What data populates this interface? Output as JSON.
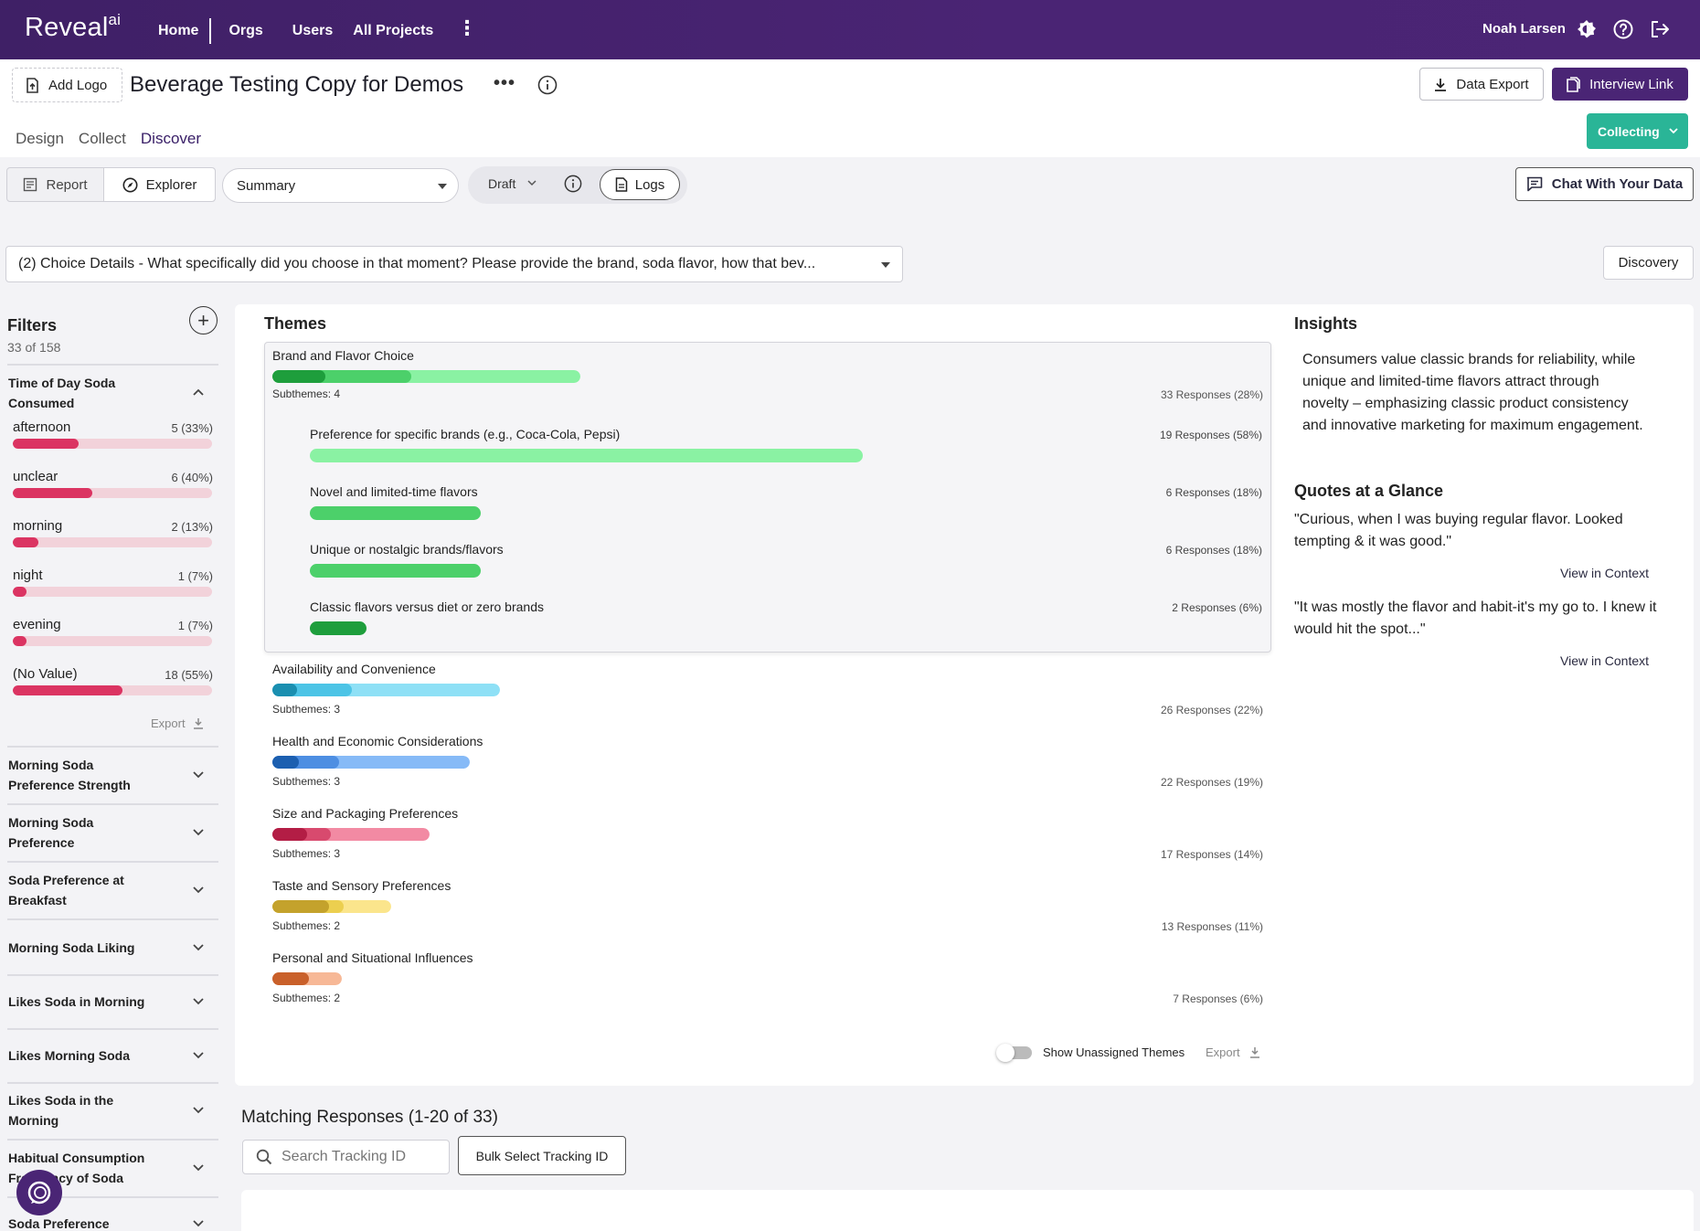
{
  "nav": {
    "logo": "Reveal",
    "logo_sup": "ai",
    "home": "Home",
    "orgs": "Orgs",
    "users": "Users",
    "all_projects": "All Projects",
    "user_name": "Noah Larsen"
  },
  "header": {
    "add_logo": "Add Logo",
    "title": "Beverage Testing Copy for Demos",
    "data_export": "Data Export",
    "interview_link": "Interview Link",
    "collecting": "Collecting",
    "tabs": [
      "Design",
      "Collect",
      "Discover"
    ],
    "active_tab": "Discover"
  },
  "toolbar": {
    "report": "Report",
    "explorer": "Explorer",
    "summary": "Summary",
    "draft": "Draft",
    "logs": "Logs",
    "chat": "Chat With Your Data",
    "question": "(2) Choice Details - What specifically did you choose in that moment? Please provide the brand, soda flavor, how that bev...",
    "discovery": "Discovery"
  },
  "filters": {
    "title": "Filters",
    "count": "33 of 158",
    "expanded_group": "Time of Day Soda Consumed",
    "values": [
      {
        "label": "afternoon",
        "count": "5 (33%)",
        "pct": 33
      },
      {
        "label": "unclear",
        "count": "6 (40%)",
        "pct": 40
      },
      {
        "label": "morning",
        "count": "2 (13%)",
        "pct": 13
      },
      {
        "label": "night",
        "count": "1 (7%)",
        "pct": 7
      },
      {
        "label": "evening",
        "count": "1 (7%)",
        "pct": 7
      },
      {
        "label": "(No Value)",
        "count": "18 (55%)",
        "pct": 55
      }
    ],
    "export": "Export",
    "groups": [
      "Morning Soda Preference Strength",
      "Morning Soda Preference",
      "Soda Preference at Breakfast",
      "Morning Soda Liking",
      "Likes Soda in Morning",
      "Likes Morning Soda",
      "Likes Soda in the Morning",
      "Habitual Consumption Frequency of Soda",
      "Soda Preference"
    ]
  },
  "themes": {
    "title": "Themes",
    "items": [
      {
        "name": "Brand and Flavor Choice",
        "subthemes": "Subthemes: 4",
        "responses": "33 Responses (28%)"
      },
      {
        "name": "Availability and Convenience",
        "subthemes": "Subthemes: 3",
        "responses": "26 Responses (22%)"
      },
      {
        "name": "Health and Economic Considerations",
        "subthemes": "Subthemes: 3",
        "responses": "22 Responses (19%)"
      },
      {
        "name": "Size and Packaging Preferences",
        "subthemes": "Subthemes: 3",
        "responses": "17 Responses (14%)"
      },
      {
        "name": "Taste and Sensory Preferences",
        "subthemes": "Subthemes: 2",
        "responses": "13 Responses (11%)"
      },
      {
        "name": "Personal and Situational Influences",
        "subthemes": "Subthemes: 2",
        "responses": "7 Responses (6%)"
      }
    ],
    "subthemes": [
      {
        "name": "Preference for specific brands (e.g., Coca-Cola, Pepsi)",
        "responses": "19 Responses (58%)"
      },
      {
        "name": "Novel and limited-time flavors",
        "responses": "6 Responses (18%)"
      },
      {
        "name": "Unique or nostalgic brands/flavors",
        "responses": "6 Responses (18%)"
      },
      {
        "name": "Classic flavors versus diet or zero brands",
        "responses": "2 Responses (6%)"
      }
    ],
    "show_unassigned": "Show Unassigned Themes",
    "export": "Export",
    "colors": {
      "green": [
        "#1e9e3c",
        "#4cd06a",
        "#8af2a3"
      ],
      "cyan": [
        "#1a8fb0",
        "#4cc4e6",
        "#8ee0f6"
      ],
      "blue": [
        "#1c5fb0",
        "#4d8ee2",
        "#86baf7"
      ],
      "red": [
        "#b31d45",
        "#d84a6e",
        "#f28aa3"
      ],
      "yellow": [
        "#c4a22c",
        "#eccf4f",
        "#fbe58c"
      ],
      "orange": [
        "#c9602a",
        "#f0925f",
        "#f7b896"
      ]
    }
  },
  "insights": {
    "title": "Insights",
    "text": "Consumers value classic brands for reliability, while unique and limited-time flavors attract through novelty – emphasizing classic product consistency and innovative marketing for maximum engagement.",
    "quotes_title": "Quotes at a Glance",
    "quotes": [
      "\"Curious, when I was buying regular flavor. Looked tempting & it was good.\"",
      "\"It was mostly the flavor and habit-it's my go to. I knew it would hit the spot...\""
    ],
    "view_in_context": "View in Context"
  },
  "matching": {
    "title": "Matching Responses (1-20 of 33)",
    "search_placeholder": "Search Tracking ID",
    "bulk_select": "Bulk Select Tracking ID"
  }
}
